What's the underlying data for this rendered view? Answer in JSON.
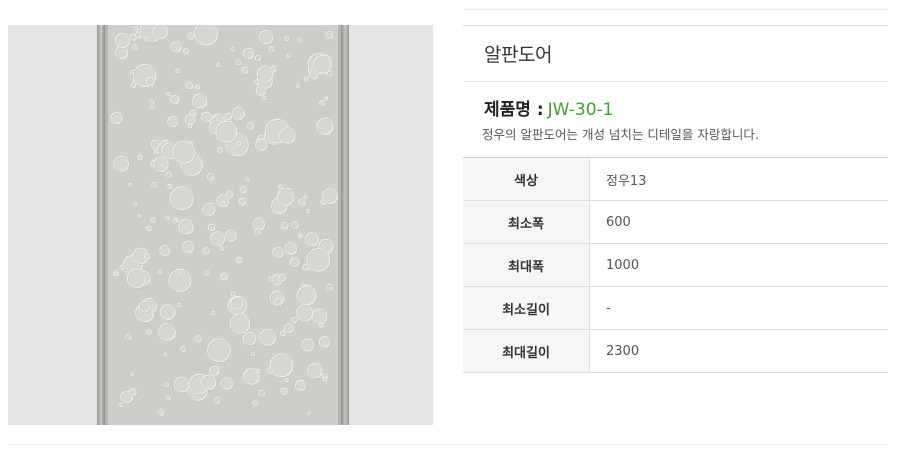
{
  "product": {
    "title": "알판도어",
    "model_label": "제품명 :",
    "model_code": "JW-30-1",
    "description": "정우의 알판도어는 개성 넘치는 디테일을 자랑합니다.",
    "image_alt": "door panel image"
  },
  "specs": [
    {
      "label": "색상",
      "value": "정우13"
    },
    {
      "label": "최소폭",
      "value": "600"
    },
    {
      "label": "최대폭",
      "value": "1000"
    },
    {
      "label": "최소길이",
      "value": "-"
    },
    {
      "label": "최대길이",
      "value": "2300"
    }
  ],
  "colors": {
    "accent": "#43a02c",
    "panel": "#cfcdc9",
    "image_bg": "#e6e5e4"
  }
}
